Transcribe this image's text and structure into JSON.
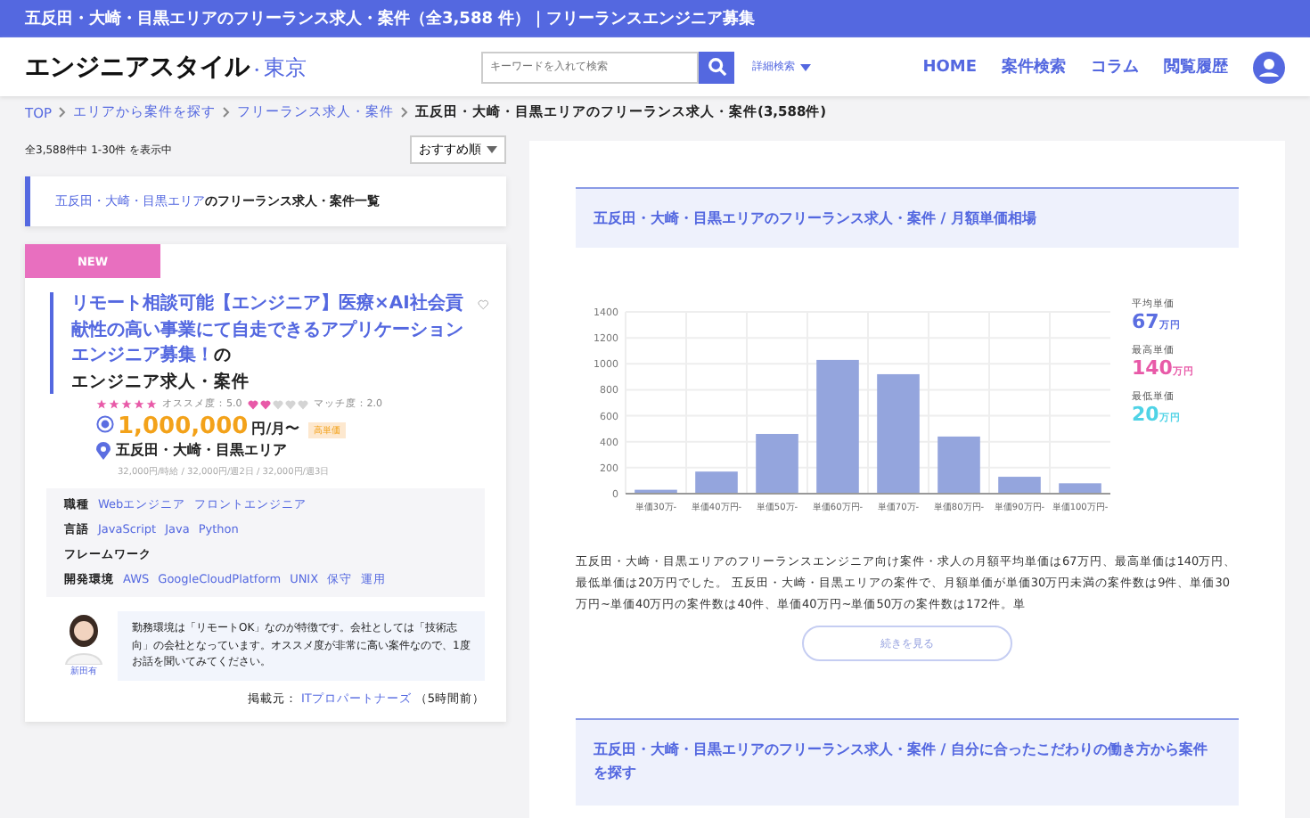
{
  "topbar": {
    "title": "五反田・大崎・目黒エリアのフリーランス求人・案件（全3,588 件）｜フリーランスエンジニア募集"
  },
  "header": {
    "logo": "エンジニアスタイル",
    "logo_mark": "・",
    "logo_sub": "東京",
    "search": {
      "placeholder": "キーワードを入れて検索"
    },
    "advanced": "詳細検索",
    "nav": [
      "HOME",
      "案件検索",
      "コラム",
      "閲覧履歴"
    ]
  },
  "breadcrumb": [
    {
      "label": "TOP",
      "link": true
    },
    {
      "label": "エリアから案件を探す",
      "link": true
    },
    {
      "label": "フリーランス求人・案件",
      "link": true
    },
    {
      "label": "五反田・大崎・目黒エリアのフリーランス求人・案件(3,588件)",
      "link": false
    }
  ],
  "results": {
    "count": "全3,588件中 1-30件 を表示中",
    "sort": "おすすめ順"
  },
  "list_heading": {
    "area": "五反田・大崎・目黒エリア",
    "rest": "のフリーランス求人・案件一覧"
  },
  "job": {
    "badge": "NEW",
    "title": "リモート相談可能【エンジニア】医療×AI社会貢献性の高い事業にて自走できるアプリケーションエンジニア募集！",
    "title_suffix": "の",
    "subtitle": "エンジニア求人・案件",
    "favorite": false,
    "ratings": [
      {
        "label": "オススメ度：5.0",
        "stars": 5,
        "kind": "star"
      },
      {
        "label": "マッチ度：2.0",
        "stars": 2,
        "kind": "heart"
      }
    ],
    "salary": "1,000,000",
    "salary_unit": "円/月〜",
    "salary_tag": "高単価",
    "location": "五反田・大崎・目黒エリア",
    "rates": "32,000円/時給 / 32,000円/週2日 / 32,000円/週3日",
    "specs": [
      {
        "label": "職種",
        "values": [
          "Webエンジニア",
          "フロントエンジニア"
        ]
      },
      {
        "label": "言語",
        "values": [
          "JavaScript",
          "Java",
          "Python"
        ]
      },
      {
        "label": "フレームワーク"
      },
      {
        "label": "開発環境",
        "values": [
          "AWS",
          "GoogleCloudPlatform",
          "UNIX",
          "保守",
          "運用"
        ]
      }
    ],
    "agent_name": "新田有",
    "comment": "勤務環境は「リモートOK」なのが特徴です。会社としては「技術志向」の会社となっています。オススメ度が非常に高い案件なので、1度お話を聞いてみてください。",
    "source_label": "掲載元：",
    "source": "ITプロパートナーズ",
    "age": "（5時間前）"
  },
  "market": {
    "heading": "五反田・大崎・目黒エリアのフリーランス求人・案件 / 月額単価相場",
    "chart_data": {
      "type": "bar",
      "grid": true,
      "categories": [
        "単価30万-",
        "単価40万円-",
        "単価50万-",
        "単価60万円-",
        "単価70万-",
        "単価80万円-",
        "単価90万円-",
        "単価100万円-"
      ],
      "series": [
        {
          "color": "#94a5dd",
          "values": [
            30,
            170,
            460,
            1030,
            920,
            440,
            130,
            80
          ]
        }
      ],
      "ylim": [
        0,
        1400
      ],
      "yticks": [
        0,
        200,
        400,
        600,
        800,
        1000,
        1200,
        1400
      ]
    },
    "stats": [
      {
        "label": "平均単価",
        "value": "67",
        "unit": "万円",
        "color": "#5b6ee1"
      },
      {
        "label": "最高単価",
        "value": "140",
        "unit": "万円",
        "color": "#e85aa8"
      },
      {
        "label": "最低単価",
        "value": "20",
        "unit": "万円",
        "color": "#4fd3e6"
      }
    ],
    "summary": "五反田・大崎・目黒エリアのフリーランスエンジニア向け案件・求人の月額平均単価は67万円、最高単価は140万円、最低単価は20万円でした。 五反田・大崎・目黒エリアの案件で、月額単価が単価30万円未満の案件数は9件、単価30万円~単価40万円の案件数は40件、単価40万円~単価50万の案件数は172件。単",
    "more": "続きを見る"
  },
  "style_heading": "五反田・大崎・目黒エリアのフリーランス求人・案件 / 自分に合ったこだわりの働き方から案件を探す"
}
